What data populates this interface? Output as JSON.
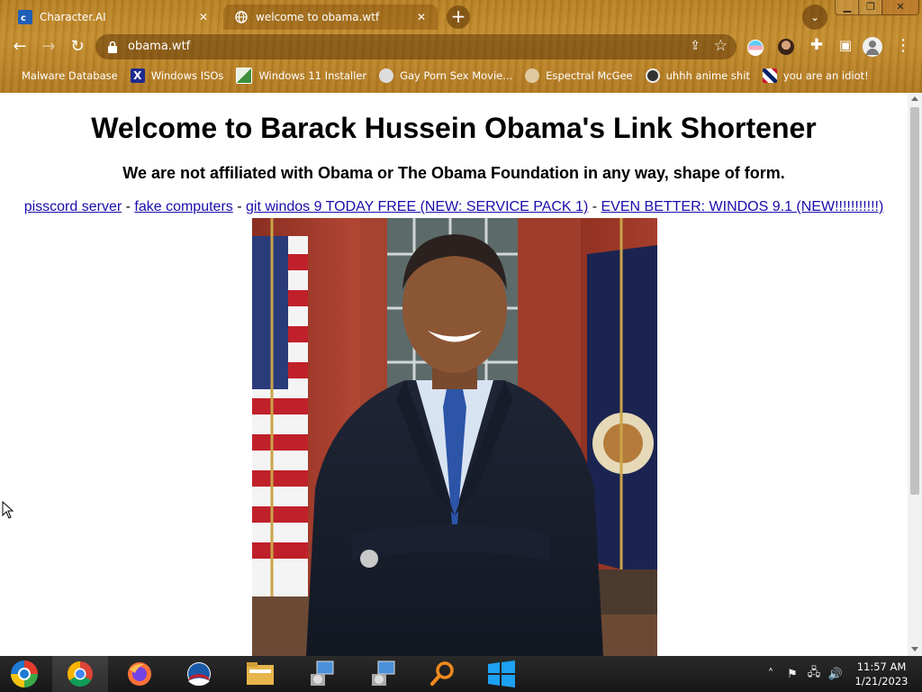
{
  "browser": {
    "tabs": [
      {
        "title": "Character.AI",
        "favicon": "character-ai-icon"
      },
      {
        "title": "welcome to obama.wtf",
        "favicon": "globe-icon"
      }
    ],
    "address": "obama.wtf",
    "bookmarks": [
      {
        "label": "Malware Database",
        "icon": "malware-icon"
      },
      {
        "label": "Windows ISOs",
        "icon": "x-icon"
      },
      {
        "label": "Windows 11 Installer",
        "icon": "installer-icon"
      },
      {
        "label": "Gay Porn Sex Movie...",
        "icon": "bookmark-icon"
      },
      {
        "label": "Espectral McGee",
        "icon": "bookmark-icon"
      },
      {
        "label": "uhhh anime shit",
        "icon": "anime-icon"
      },
      {
        "label": "you are an idiot!",
        "icon": "flag-icon"
      }
    ]
  },
  "page": {
    "headline": "Welcome to Barack Hussein Obama's Link Shortener",
    "subheadline": "We are not affiliated with Obama or The Obama Foundation in any way, shape of form.",
    "links": [
      "pisscord server",
      "fake computers",
      "git windos 9 TODAY FREE (NEW: SERVICE PACK 1)",
      "EVEN BETTER: WINDOS 9.1 (NEW!!!!!!!!!!!)"
    ],
    "separator": " - "
  },
  "taskbar": {
    "apps": [
      "app-1-icon",
      "chrome-icon",
      "firefox-icon",
      "obama-logo-icon",
      "file-explorer-icon",
      "install-icon",
      "install-icon",
      "search-icon",
      "windows-icon"
    ]
  },
  "clock": {
    "time": "11:57 AM",
    "date": "1/21/2023"
  },
  "colors": {
    "chrome_frame": "#b98124",
    "link": "#1a0dab",
    "taskbar": "#1e1e1e"
  }
}
